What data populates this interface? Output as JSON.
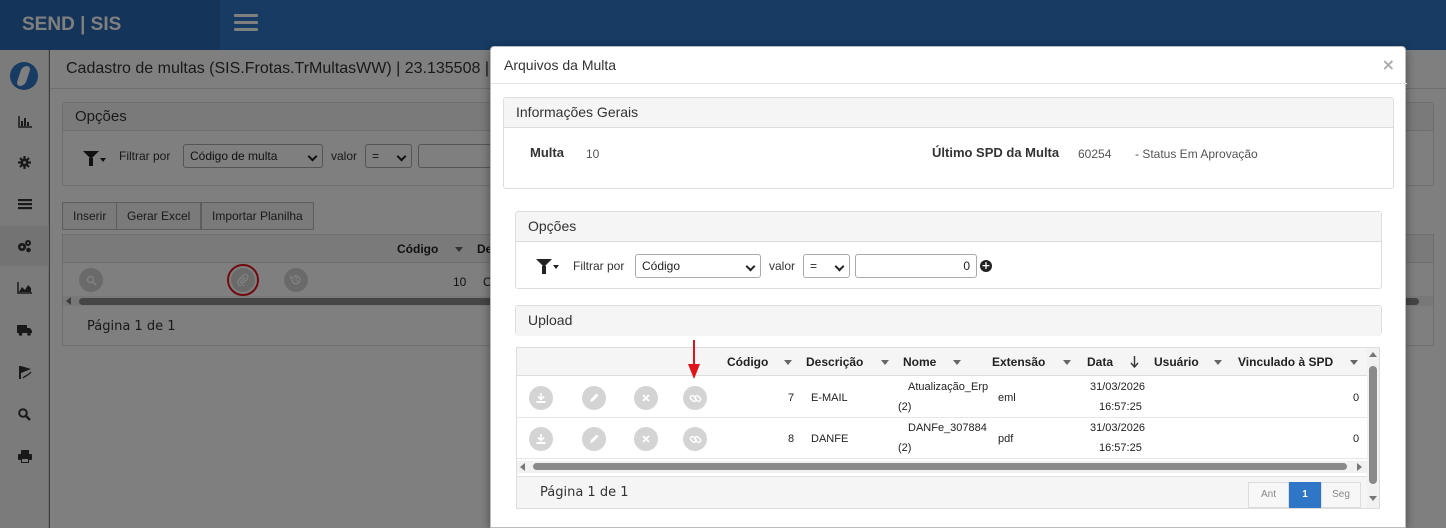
{
  "app": {
    "brand": "SEND | SIS"
  },
  "sidenav": {
    "icons": [
      "logo-icon",
      "bar-chart-icon",
      "gear-icon",
      "list-icon",
      "gears-icon",
      "area-chart-icon",
      "truck-icon",
      "route-icon",
      "search-icon",
      "print-icon"
    ]
  },
  "base_page": {
    "breadcrumb": "Cadastro de multas (SIS.Frotas.TrMultasWW) | 23.135508 |",
    "options_title": "Opções",
    "filter_label": "Filtrar por",
    "filter_field": "Código de multa",
    "value_label": "valor",
    "operator": "=",
    "buttons": {
      "insert": "Inserir",
      "excel": "Gerar Excel",
      "import": "Importar Planilha"
    },
    "columns": [
      "Código",
      "De"
    ],
    "rows": [
      {
        "codigo": "10",
        "desc": "C"
      }
    ],
    "pager": "Página 1 de 1"
  },
  "modal": {
    "title": "Arquivos da Multa",
    "close": "×",
    "info": {
      "title": "Informações Gerais",
      "multa_label": "Multa",
      "multa_value": "10",
      "spd_label": "Último SPD da Multa",
      "spd_value": "60254",
      "status": "- Status Em Aprovação"
    },
    "options": {
      "title": "Opções",
      "filter_label": "Filtrar por",
      "filter_field": "Código",
      "value_label": "valor",
      "operator": "=",
      "value": "0",
      "plus": "+"
    },
    "upload": {
      "title": "Upload",
      "columns": {
        "codigo": "Código",
        "descricao": "Descrição",
        "nome": "Nome",
        "extensao": "Extensão",
        "data": "Data",
        "usuario": "Usuário",
        "vinculado": "Vinculado à SPD"
      },
      "rows": [
        {
          "codigo": "7",
          "descricao": "E-MAIL",
          "nome_l1": "Atualização_Erp",
          "nome_l2": "(2)",
          "extensao": "eml",
          "date": "31/03/2026",
          "time": "16:57:25",
          "usuario": "",
          "vinculado": "0"
        },
        {
          "codigo": "8",
          "descricao": "DANFE",
          "nome_l1": "DANFe_307884",
          "nome_l2": "(2)",
          "extensao": "pdf",
          "date": "31/03/2026",
          "time": "16:57:25",
          "usuario": "",
          "vinculado": "0"
        }
      ],
      "pager": {
        "text": "Página 1 de 1",
        "prev": "Ant",
        "current": "1",
        "next": "Seg"
      }
    }
  },
  "colors": {
    "brand": "#2a69b4",
    "topbar": "#2f76c6",
    "highlight": "#e0151b"
  }
}
